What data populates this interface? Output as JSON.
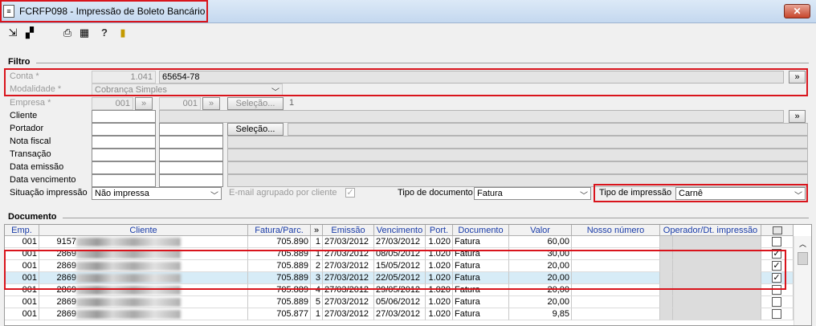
{
  "window": {
    "title": "FCRFP098 - Impressão de Boleto Bancário",
    "close": "✕"
  },
  "toolbar": {
    "icons": [
      "arrow-icon",
      "export-icon",
      "print-icon",
      "calendar-icon",
      "help-icon",
      "exit-icon"
    ]
  },
  "filtro": {
    "title": "Filtro",
    "conta": {
      "label": "Conta *",
      "code": "1.041",
      "value": "65654-78",
      "more": "»"
    },
    "modalidade": {
      "label": "Modalidade *",
      "value": "Cobrança Simples"
    },
    "empresa": {
      "label": "Empresa *",
      "code1": "001",
      "code2": "001",
      "selecao": "Seleção...",
      "count": "1",
      "more": "»"
    },
    "cliente": {
      "label": "Cliente",
      "more": "»"
    },
    "portador": {
      "label": "Portador",
      "selecao": "Seleção..."
    },
    "nota_fiscal": {
      "label": "Nota fiscal"
    },
    "transacao": {
      "label": "Transação"
    },
    "data_emissao": {
      "label": "Data emissão"
    },
    "data_vencimento": {
      "label": "Data vencimento"
    },
    "situacao": {
      "label": "Situação impressão",
      "value": "Não impressa"
    },
    "email": {
      "label": "E-mail agrupado por cliente"
    },
    "tipo_documento": {
      "label": "Tipo de documento",
      "value": "Fatura"
    },
    "tipo_impressao": {
      "label": "Tipo de impressão",
      "value": "Carnê"
    }
  },
  "documento": {
    "title": "Documento",
    "headers": [
      "Emp.",
      "Cliente",
      "Fatura/Parc.",
      "»",
      "Emissão",
      "Vencimento",
      "Port.",
      "Documento",
      "Valor",
      "Nosso número",
      "Operador/Dt. impressão",
      ""
    ],
    "rows": [
      {
        "emp": "001",
        "cli": "9157",
        "fat": "705.890",
        "parc": "1",
        "emis": "27/03/2012",
        "venc": "27/03/2012",
        "port": "1.020",
        "doc": "Fatura",
        "valor": "60,00",
        "checked": false
      },
      {
        "emp": "001",
        "cli": "2869",
        "fat": "705.889",
        "parc": "1",
        "emis": "27/03/2012",
        "venc": "08/05/2012",
        "port": "1.020",
        "doc": "Fatura",
        "valor": "30,00",
        "checked": true
      },
      {
        "emp": "001",
        "cli": "2869",
        "fat": "705.889",
        "parc": "2",
        "emis": "27/03/2012",
        "venc": "15/05/2012",
        "port": "1.020",
        "doc": "Fatura",
        "valor": "20,00",
        "checked": true
      },
      {
        "emp": "001",
        "cli": "2869",
        "fat": "705.889",
        "parc": "3",
        "emis": "27/03/2012",
        "venc": "22/05/2012",
        "port": "1.020",
        "doc": "Fatura",
        "valor": "20,00",
        "checked": true
      },
      {
        "emp": "001",
        "cli": "2869",
        "fat": "705.889",
        "parc": "4",
        "emis": "27/03/2012",
        "venc": "29/05/2012",
        "port": "1.020",
        "doc": "Fatura",
        "valor": "20,00",
        "checked": false
      },
      {
        "emp": "001",
        "cli": "2869",
        "fat": "705.889",
        "parc": "5",
        "emis": "27/03/2012",
        "venc": "05/06/2012",
        "port": "1.020",
        "doc": "Fatura",
        "valor": "20,00",
        "checked": false
      },
      {
        "emp": "001",
        "cli": "2869",
        "fat": "705.877",
        "parc": "1",
        "emis": "27/03/2012",
        "venc": "27/03/2012",
        "port": "1.020",
        "doc": "Fatura",
        "valor": "9,85",
        "checked": false
      }
    ]
  }
}
